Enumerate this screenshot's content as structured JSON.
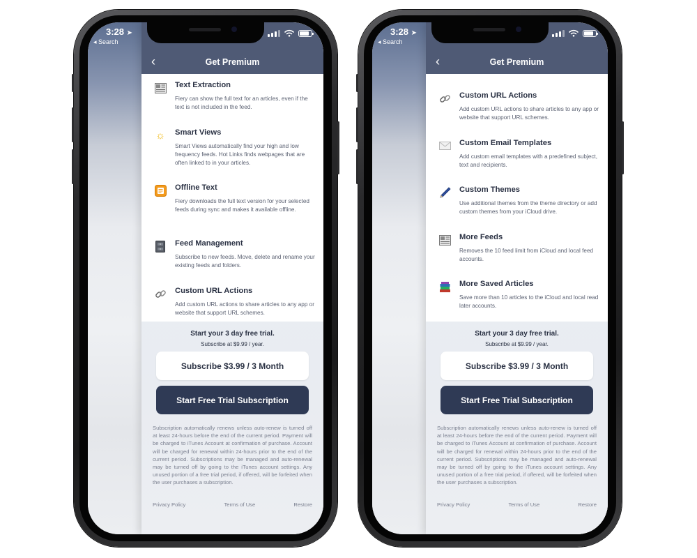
{
  "status": {
    "time": "3:28",
    "back_label": "◂ Search"
  },
  "nav": {
    "title": "Get Premium",
    "back_icon": "‹"
  },
  "colors": {
    "nav_bar": "#4f5a75",
    "primary_button": "#2f3a55",
    "text": "#2b3244"
  },
  "phones": [
    {
      "features": [
        {
          "icon": "text-extraction-icon",
          "title": "Text Extraction",
          "desc": "Fiery can show the full text for an articles, even if the text is not included in the feed."
        },
        {
          "icon": "sun-icon",
          "title": "Smart Views",
          "desc": "Smart Views automatically find your high and low frequency feeds. Hot Links finds webpages that are often linked to in your articles."
        },
        {
          "icon": "offline-text-icon",
          "title": "Offline Text",
          "desc": "Fiery downloads the full text version for your selected feeds during sync and makes it available offline."
        },
        {
          "icon": "cabinet-icon",
          "title": "Feed Management",
          "desc": "Subscribe to new feeds. Move, delete and rename your existing feeds and folders."
        },
        {
          "icon": "link-icon",
          "title": "Custom URL Actions",
          "desc": "Add custom URL actions to share articles to any app or website that support URL schemes."
        }
      ]
    },
    {
      "features": [
        {
          "icon": "link-icon",
          "title": "Custom URL Actions",
          "desc": "Add custom URL actions to share articles to any app or website that support URL schemes."
        },
        {
          "icon": "envelope-icon",
          "title": "Custom Email Templates",
          "desc": "Add custom email templates with a predefined subject, text and recipients."
        },
        {
          "icon": "pen-icon",
          "title": "Custom Themes",
          "desc": "Use additional themes from the theme directory or add custom themes from your iCloud drive."
        },
        {
          "icon": "more-feeds-icon",
          "title": "More Feeds",
          "desc": "Removes the 10 feed limit from iCloud and local feed accounts."
        },
        {
          "icon": "books-icon",
          "title": "More Saved Articles",
          "desc": "Save more than 10 articles to the iCloud and local read later accounts."
        }
      ]
    }
  ],
  "paywall": {
    "trial_title": "Start your 3 day free trial.",
    "trial_sub": "Subscribe at $9.99 / year.",
    "subscribe_button": "Subscribe $3.99 / 3 Month",
    "trial_button": "Start Free Trial Subscription",
    "terms": "Subscription automatically renews unless auto-renew is turned off at least 24-hours before the end of the current period. Payment will be charged to iTunes Account at confirmation of purchase. Account will be charged for renewal within 24-hours prior to the end of the current period. Subscriptions may be managed and auto-renewal may be turned off by going to the iTunes account settings. Any unused portion of a free trial period, if offered, will be forfeited when the user purchases a subscription.",
    "links": {
      "privacy": "Privacy Policy",
      "terms": "Terms of Use",
      "restore": "Restore"
    }
  }
}
